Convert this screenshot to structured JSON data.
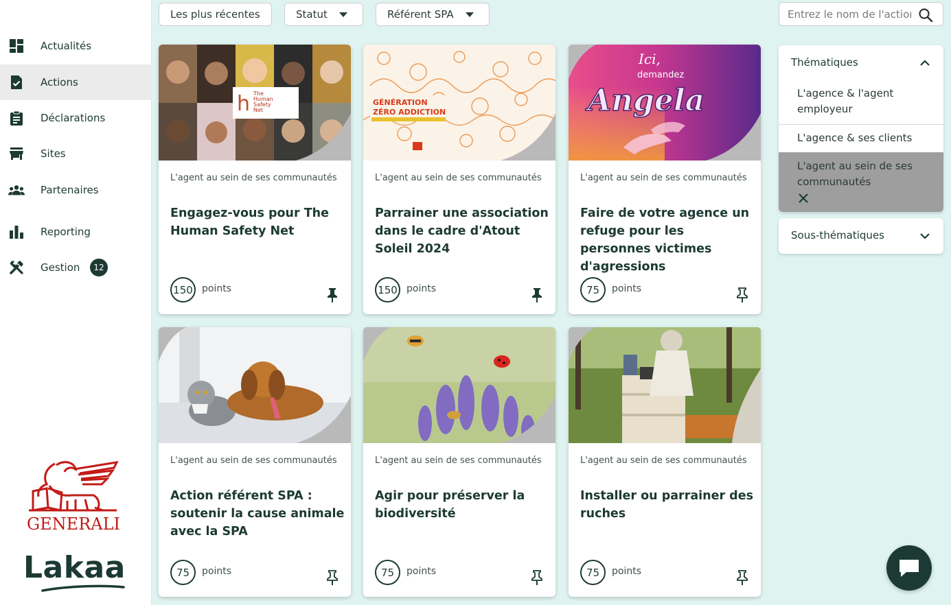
{
  "sidebar": {
    "items": [
      {
        "label": "Actualités",
        "icon": "dashboard-icon"
      },
      {
        "label": "Actions",
        "icon": "task-check-icon"
      },
      {
        "label": "Déclarations",
        "icon": "clipboard-icon"
      },
      {
        "label": "Sites",
        "icon": "store-icon"
      },
      {
        "label": "Partenaires",
        "icon": "group-icon"
      },
      {
        "label": "Reporting",
        "icon": "bar-chart-icon"
      },
      {
        "label": "Gestion",
        "icon": "tools-icon",
        "badge": "12"
      }
    ],
    "brand": {
      "company": "GENERALI",
      "app": "Lakaa"
    }
  },
  "filters": {
    "sort_label": "Les plus récentes",
    "status_label": "Statut",
    "referent_label": "Référent SPA",
    "search_placeholder": "Entrez le nom de l'action"
  },
  "cards": [
    {
      "theme": "L'agent au sein de ses communautés",
      "title": "Engagez-vous pour The Human Safety Net",
      "points": "150",
      "points_label": "points",
      "image_text": [
        "The",
        "Human",
        "Safety",
        "Net"
      ]
    },
    {
      "theme": "L'agent au sein de ses communautés",
      "title": "Parrainer une association dans le cadre d'Atout Soleil 2024",
      "points": "150",
      "points_label": "points",
      "image_text": [
        "GÉNÉRATION",
        "ZÉRO ADDICTION"
      ]
    },
    {
      "theme": "L'agent au sein de ses communautés",
      "title": "Faire de votre agence un refuge pour les personnes victimes d'agressions",
      "points": "75",
      "points_label": "points",
      "image_text": [
        "Ici,",
        "demandez",
        "Angela"
      ]
    },
    {
      "theme": "L'agent au sein de ses communautés",
      "title": "Action référent SPA : soutenir la cause animale avec la SPA",
      "points": "75",
      "points_label": "points"
    },
    {
      "theme": "L'agent au sein de ses communautés",
      "title": "Agir pour préserver la biodiversité",
      "points": "75",
      "points_label": "points"
    },
    {
      "theme": "L'agent au sein de ses communautés",
      "title": "Installer ou parrainer des ruches",
      "points": "75",
      "points_label": "points"
    }
  ],
  "thematiques": {
    "title": "Thématiques",
    "options": [
      {
        "label": "L'agence & l'agent employeur",
        "selected": false
      },
      {
        "label": "L'agence & ses clients",
        "selected": false
      },
      {
        "label": "L'agent au sein de ses communautés",
        "selected": true
      }
    ]
  },
  "sous_thematiques": {
    "title": "Sous-thématiques"
  },
  "colors": {
    "primary": "#1c3a33",
    "background": "#dff3f1",
    "brand_red": "#c21b17",
    "selected": "#9e9e9e"
  }
}
